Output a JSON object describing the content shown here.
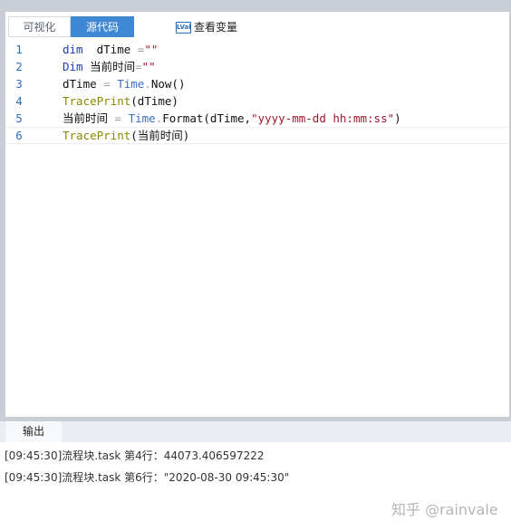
{
  "tabs": {
    "visual_label": "可视化",
    "source_label": "源代码",
    "view_vars_label": "查看变量",
    "view_vars_icon_text": "LVal"
  },
  "editor": {
    "lines": [
      {
        "number": "1",
        "tokens": [
          [
            "kw",
            "dim"
          ],
          [
            "plain",
            "  dTime "
          ],
          [
            "op",
            "="
          ],
          [
            "str",
            "\"\""
          ]
        ]
      },
      {
        "number": "2",
        "tokens": [
          [
            "kw",
            "Dim"
          ],
          [
            "plain",
            " 当前时间"
          ],
          [
            "op",
            "="
          ],
          [
            "str",
            "\"\""
          ]
        ]
      },
      {
        "number": "3",
        "tokens": [
          [
            "plain",
            "dTime "
          ],
          [
            "op",
            "="
          ],
          [
            "plain",
            " "
          ],
          [
            "obj",
            "Time"
          ],
          [
            "op",
            "."
          ],
          [
            "plain",
            "Now()"
          ]
        ]
      },
      {
        "number": "4",
        "tokens": [
          [
            "fn",
            "TracePrint"
          ],
          [
            "plain",
            "(dTime)"
          ]
        ]
      },
      {
        "number": "5",
        "tokens": [
          [
            "plain",
            "当前时间 "
          ],
          [
            "op",
            "="
          ],
          [
            "plain",
            " "
          ],
          [
            "obj",
            "Time"
          ],
          [
            "op",
            "."
          ],
          [
            "plain",
            "Format(dTime,"
          ],
          [
            "str",
            "\"yyyy-mm-dd hh:mm:ss\""
          ],
          [
            "plain",
            ")"
          ]
        ]
      },
      {
        "number": "6",
        "tokens": [
          [
            "fn",
            "TracePrint"
          ],
          [
            "plain",
            "(当前时间)"
          ]
        ]
      }
    ]
  },
  "output": {
    "tab_label": "输出",
    "logs": [
      "[09:45:30]流程块.task 第4行：44073.406597222",
      "[09:45:30]流程块.task 第6行：\"2020-08-30 09:45:30\""
    ]
  },
  "watermark": "知乎 @rainvale"
}
